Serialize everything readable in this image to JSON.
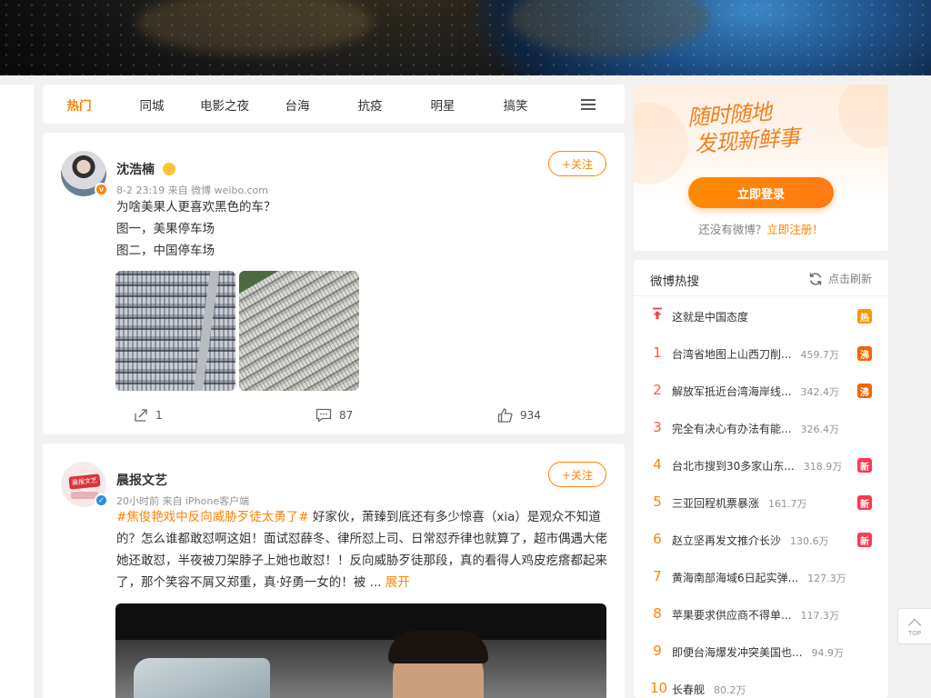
{
  "nav": {
    "tabs": [
      {
        "label": "热门",
        "active": true
      },
      {
        "label": "同城"
      },
      {
        "label": "电影之夜"
      },
      {
        "label": "台海"
      },
      {
        "label": "抗疫"
      },
      {
        "label": "明星"
      },
      {
        "label": "搞笑"
      }
    ],
    "menu_icon": "list-menu-icon"
  },
  "posts": [
    {
      "author": "沈浩楠",
      "author_badge_icon": "emoji-badge-icon",
      "verified_color": "#ff8200",
      "meta": "8-2 23:19  来自 微博 weibo.com",
      "follow_label": "+关注",
      "lines": [
        "为啥美果人更喜欢黑色的车？",
        "图一，美果停车场",
        "图二，中国停车场"
      ],
      "images": [
        "parking-lot-photo-1",
        "parking-lot-photo-2"
      ],
      "actions": {
        "repost": "1",
        "comment": "87",
        "like": "934"
      }
    },
    {
      "author": "晨报文艺",
      "avatar_text": "晨报文艺",
      "verified_color": "#2a8de0",
      "meta": "20小时前  来自 iPhone客户端",
      "follow_label": "+关注",
      "hashtag": "#焦俊艳戏中反向威胁歹徒太勇了#",
      "body": " 好家伙，萧臻到底还有多少惊喜（xia）是观众不知道的？怎么谁都敢怼啊这姐！面试怼薛冬、律所怼上司、日常怼乔律也就算了，超市偶遇大佬她还敢怼，半夜被刀架脖子上她也敢怼！！反向威胁歹徒那段，真的看得人鸡皮疙瘩都起来了，那个笑容不屑又郑重，真·好勇一女的！被 ... ",
      "expand_label": "展开",
      "video": "video-thumbnail"
    }
  ],
  "login": {
    "slogan_line1": "随时随地",
    "slogan_line2": "发现新鲜事",
    "button": "立即登录",
    "register_prefix": "还没有微博？",
    "register_link": "立即注册！"
  },
  "hot_search": {
    "title": "微博热搜",
    "refresh": "点击刷新",
    "items": [
      {
        "rank": "",
        "pinned": true,
        "topic": "这就是中国态度",
        "heat": "",
        "tag": "热",
        "tag_color": "#ff9406"
      },
      {
        "rank": "1",
        "topic": "台湾省地图上山西刀削...",
        "heat": "459.7万",
        "tag": "沸",
        "tag_color": "#f86400"
      },
      {
        "rank": "2",
        "topic": "解放军抵近台湾海岸线...",
        "heat": "342.4万",
        "tag": "沸",
        "tag_color": "#f86400"
      },
      {
        "rank": "3",
        "topic": "完全有决心有办法有能...",
        "heat": "326.4万",
        "tag": ""
      },
      {
        "rank": "4",
        "topic": "台北市搜到30多家山东...",
        "heat": "318.9万",
        "tag": "新",
        "tag_color": "#ff3852"
      },
      {
        "rank": "5",
        "topic": "三亚回程机票暴涨",
        "heat": "161.7万",
        "tag": "新",
        "tag_color": "#ff3852"
      },
      {
        "rank": "6",
        "topic": "赵立坚再发文推介长沙",
        "heat": "130.6万",
        "tag": "新",
        "tag_color": "#ff3852"
      },
      {
        "rank": "7",
        "topic": "黄海南部海域6日起实弹...",
        "heat": "127.3万",
        "tag": ""
      },
      {
        "rank": "8",
        "topic": "苹果要求供应商不得单...",
        "heat": "117.3万",
        "tag": ""
      },
      {
        "rank": "9",
        "topic": "即便台海爆发冲突美国也...",
        "heat": "94.9万",
        "tag": ""
      },
      {
        "rank": "10",
        "topic": "长春舰",
        "heat": "80.2万",
        "tag": ""
      }
    ]
  },
  "back_to_top": "TOP"
}
